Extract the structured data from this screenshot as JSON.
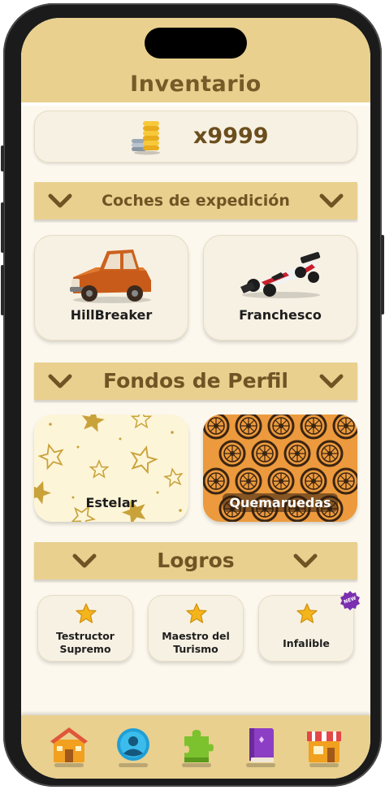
{
  "header": {
    "title": "Inventario"
  },
  "coins": {
    "count": "x9999",
    "icon": "coin-stack-icon"
  },
  "sections": {
    "vehicles": {
      "label": "Coches de expedición"
    },
    "backgrounds": {
      "label": "Fondos de Perfil"
    },
    "achievements": {
      "label": "Logros"
    }
  },
  "vehicles": [
    {
      "name": "HillBreaker",
      "icon": "orange-pickup-truck"
    },
    {
      "name": "Franchesco",
      "icon": "formula-race-car"
    }
  ],
  "backgrounds": [
    {
      "name": "Estelar",
      "pattern": "gold-stars"
    },
    {
      "name": "Quemaruedas",
      "pattern": "wheels"
    }
  ],
  "achievements": [
    {
      "title": "Testructor Supremo",
      "icon": "star-icon"
    },
    {
      "title": "Maestro del Turismo",
      "icon": "star-icon"
    },
    {
      "title": "Infalible",
      "icon": "star-icon",
      "badge": "NEW"
    }
  ],
  "nav": [
    {
      "name": "home-icon"
    },
    {
      "name": "profile-icon"
    },
    {
      "name": "puzzle-icon"
    },
    {
      "name": "book-icon"
    },
    {
      "name": "shop-icon"
    }
  ],
  "colors": {
    "header": "#e9d08f",
    "title": "#765a27",
    "background": "#fcf8ee",
    "card": "#f7f1e3",
    "star": "#f4b51c",
    "wheels_bg": "#ec9a3d"
  }
}
